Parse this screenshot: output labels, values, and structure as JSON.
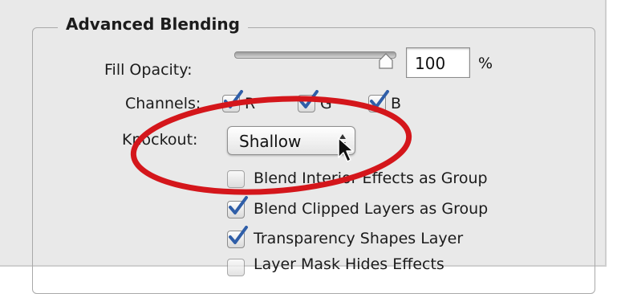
{
  "section": {
    "title": "Advanced Blending"
  },
  "fill_opacity": {
    "label": "Fill Opacity:",
    "value": "100",
    "unit": "%",
    "slider_level_percent": 100
  },
  "channels": {
    "label": "Channels:",
    "items": [
      {
        "label": "R",
        "checked": true
      },
      {
        "label": "G",
        "checked": true
      },
      {
        "label": "B",
        "checked": true
      }
    ]
  },
  "knockout": {
    "label": "Knockout:",
    "selected": "Shallow"
  },
  "options": [
    {
      "label": "Blend Interior Effects as Group",
      "checked": false
    },
    {
      "label": "Blend Clipped Layers as Group",
      "checked": true
    },
    {
      "label": "Transparency Shapes Layer",
      "checked": true
    },
    {
      "label": "Layer Mask Hides Effects",
      "checked": false
    }
  ],
  "colors": {
    "panel_bg": "#e9e9e9",
    "checkmark": "#2f5ea8",
    "highlight_circle": "#d4161b"
  }
}
